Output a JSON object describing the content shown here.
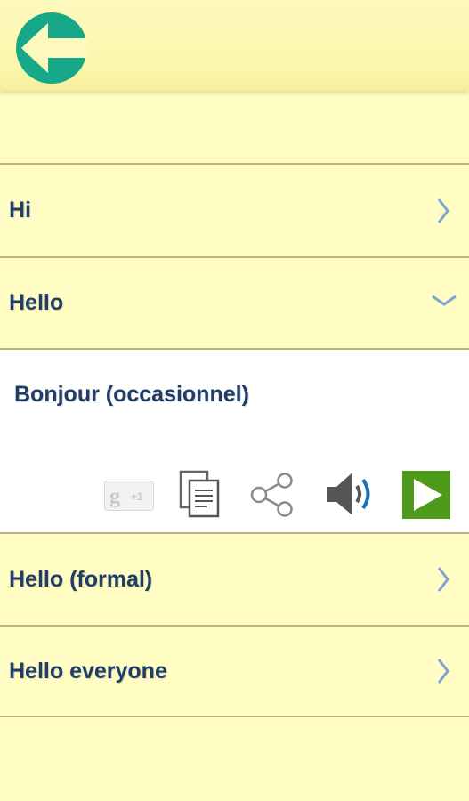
{
  "header": {
    "back_icon": "back-arrow-icon",
    "accent": "#17a88a"
  },
  "items": [
    {
      "label": "Hi",
      "state": "collapsed"
    },
    {
      "label": "Hello",
      "state": "expanded"
    },
    {
      "label": "Hello (formal)",
      "state": "collapsed"
    },
    {
      "label": "Hello everyone",
      "state": "collapsed"
    }
  ],
  "expanded": {
    "translation": "Bonjour (occasionnel)",
    "actions": {
      "gplus": {
        "letter": "g",
        "count": "+1"
      },
      "copy_icon": "copy-icon",
      "share_icon": "share-icon",
      "speaker_icon": "speaker-icon",
      "play_icon": "play-icon"
    }
  },
  "colors": {
    "background": "#fffcc4",
    "text": "#1f3d66",
    "chevron": "#7fa4d0",
    "play": "#4e9a1a"
  }
}
